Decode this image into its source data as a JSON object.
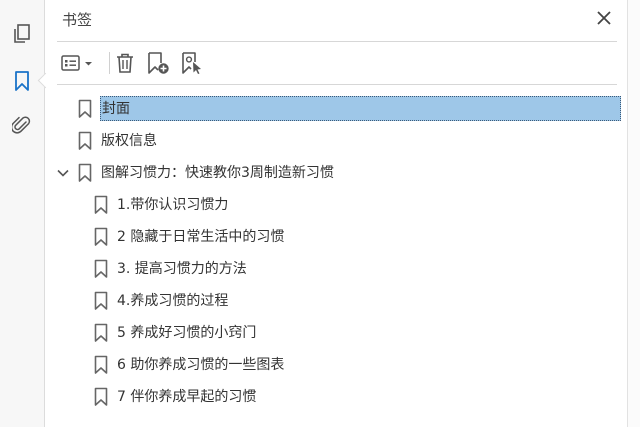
{
  "panel": {
    "title": "书签"
  },
  "toolbar": {
    "icons": [
      "options-menu-icon",
      "delete-bookmark-icon",
      "new-bookmark-icon",
      "bookmark-from-selection-icon"
    ]
  },
  "bookmarks": [
    {
      "label": "封面",
      "level": 0,
      "selected": true
    },
    {
      "label": "版权信息",
      "level": 0
    },
    {
      "label": "图解习惯力：快速教你3周制造新习惯",
      "level": 0,
      "expanded": true
    },
    {
      "label": "1.带你认识习惯力",
      "level": 1
    },
    {
      "label": "2 隐藏于日常生活中的习惯",
      "level": 1
    },
    {
      "label": "3. 提高习惯力的方法",
      "level": 1
    },
    {
      "label": "4.养成习惯的过程",
      "level": 1
    },
    {
      "label": "5 养成好习惯的小窍门",
      "level": 1
    },
    {
      "label": "6 助你养成习惯的一些图表",
      "level": 1
    },
    {
      "label": "7 伴你养成早起的习惯",
      "level": 1
    }
  ],
  "colors": {
    "accent": "#1a73c8",
    "selection": "#9ec7e8"
  }
}
